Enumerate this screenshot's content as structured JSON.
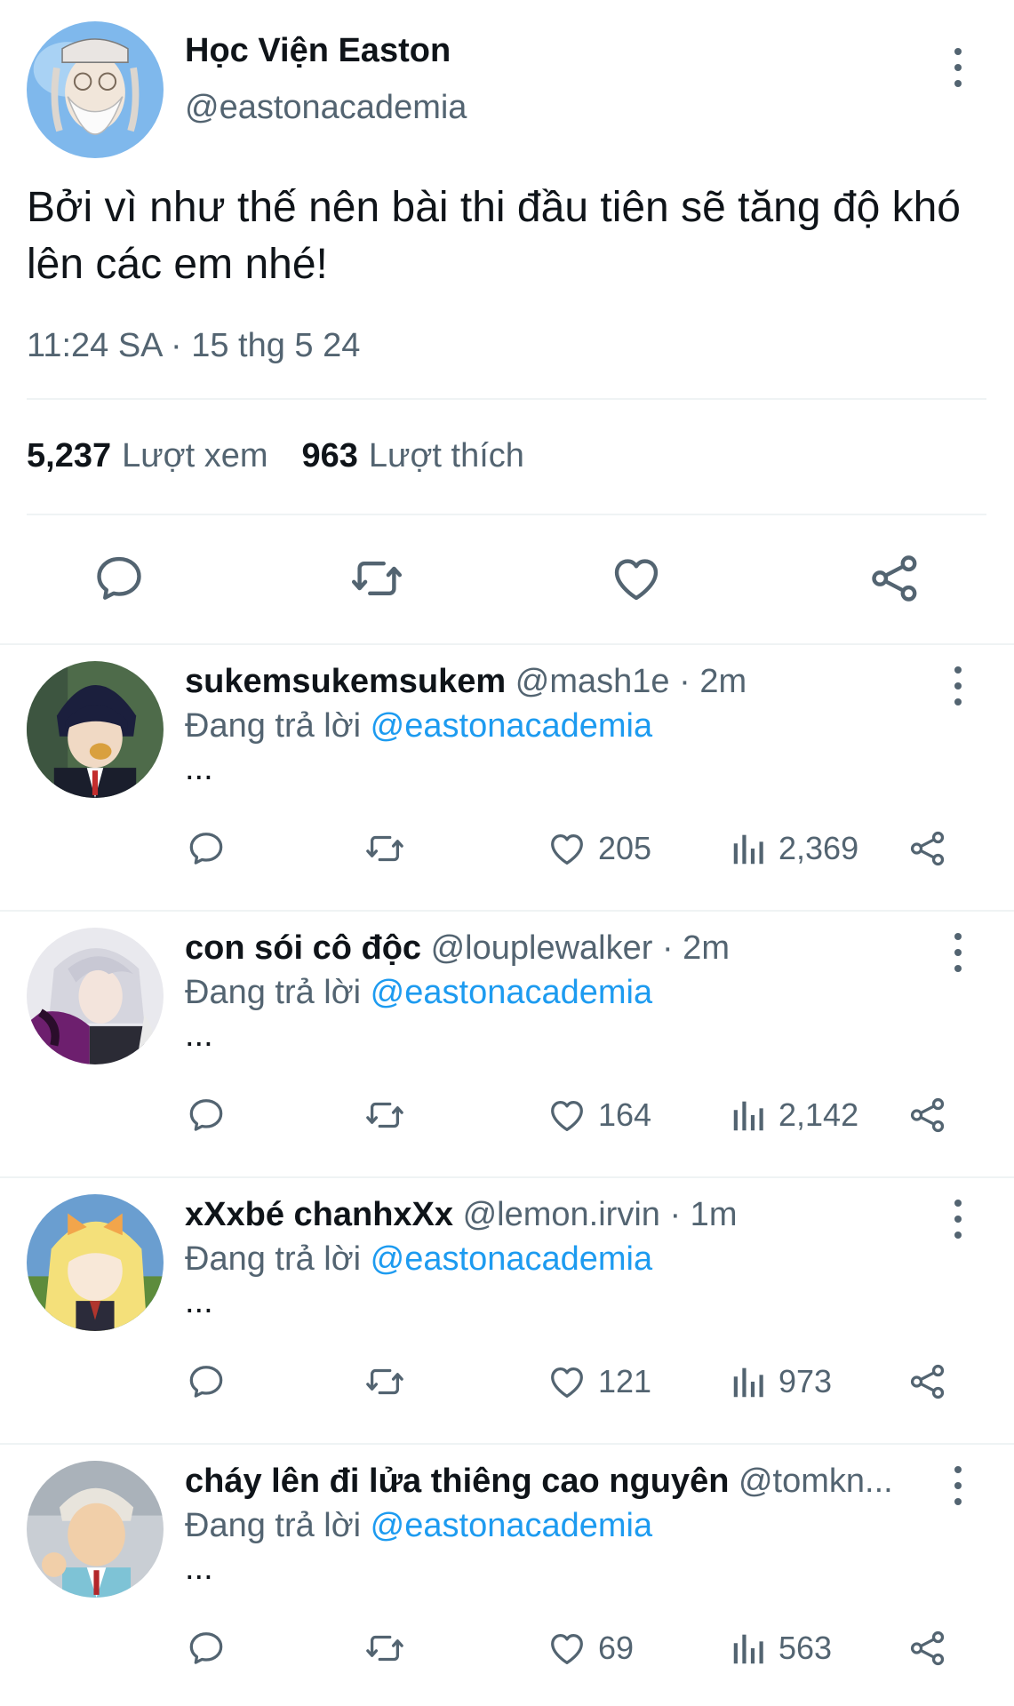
{
  "main_tweet": {
    "display_name": "Học Viện Easton",
    "handle": "@eastonacademia",
    "text": "Bởi vì như thế nên bài thi đầu tiên sẽ tăng độ khó lên các em nhé!",
    "timestamp": "11:24 SA · 15 thg 5 24",
    "views_count": "5,237",
    "views_label": "Lượt xem",
    "likes_count": "963",
    "likes_label": "Lượt thích",
    "actions": [
      "reply-icon",
      "retweet-icon",
      "heart-icon",
      "share-icon"
    ]
  },
  "replies": [
    {
      "display_name": "sukemsukemsukem",
      "handle": "@mash1e · 2m",
      "replying_prefix": "Đang trả lời",
      "replying_to": "@eastonacademia",
      "body": "...",
      "likes": "205",
      "views": "2,369"
    },
    {
      "display_name": "con sói cô độc",
      "handle": "@louplewalker · 2m",
      "replying_prefix": "Đang trả lời",
      "replying_to": "@eastonacademia",
      "body": "...",
      "likes": "164",
      "views": "2,142"
    },
    {
      "display_name": "xXxbé chanhxXx",
      "handle": "@lemon.irvin · 1m",
      "replying_prefix": "Đang trả lời",
      "replying_to": "@eastonacademia",
      "body": "...",
      "likes": "121",
      "views": "973"
    },
    {
      "display_name": "cháy lên đi lửa thiêng cao nguyên",
      "handle": "@tomkn...",
      "replying_prefix": "Đang trả lời",
      "replying_to": "@eastonacademia",
      "body": "...",
      "likes": "69",
      "views": "563"
    }
  ],
  "colors": {
    "text_primary": "#0f1419",
    "text_secondary": "#536471",
    "mention": "#1d9bf0",
    "divider": "#eff3f4"
  }
}
